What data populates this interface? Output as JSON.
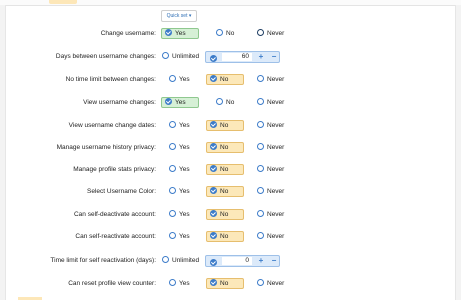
{
  "quick_set": "Quick set ▾",
  "yes": "Yes",
  "no": "No",
  "never": "Never",
  "unlimited": "Unlimited",
  "plus": "+",
  "minus": "−",
  "rows": [
    {
      "label": "Change username:",
      "selected": "yes"
    },
    {
      "label": "Days between username changes:",
      "value": "60"
    },
    {
      "label": "No time limit between changes:",
      "selected": "no"
    },
    {
      "label": "View username changes:",
      "selected": "yes"
    },
    {
      "label": "View username change dates:",
      "selected": "no"
    },
    {
      "label": "Manage username history privacy:",
      "selected": "no"
    },
    {
      "label": "Manage profile stats privacy:",
      "selected": "no"
    },
    {
      "label": "Select Username Color:",
      "selected": "no"
    },
    {
      "label": "Can self-deactivate account:",
      "selected": "no"
    },
    {
      "label": "Can self-reactivate account:",
      "selected": "no"
    },
    {
      "label": "Time limit for self reactivation (days):",
      "value": "0"
    },
    {
      "label": "Can reset profile view counter:",
      "selected": "no"
    }
  ]
}
